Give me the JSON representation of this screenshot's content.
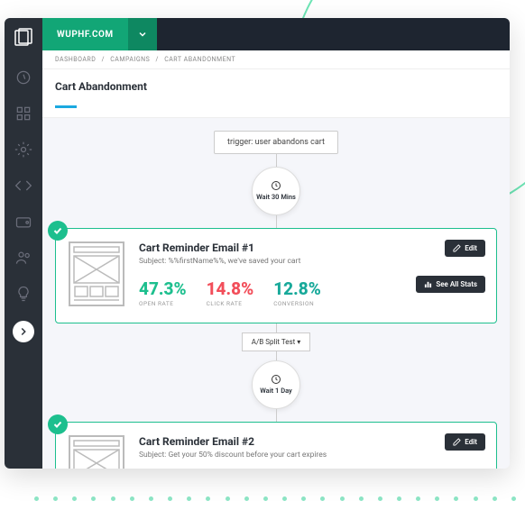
{
  "brand": "WUPHF.COM",
  "breadcrumb": {
    "a": "DASHBOARD",
    "b": "CAMPAIGNS",
    "c": "CART ABANDONMENT"
  },
  "page_title": "Cart Abandonment",
  "trigger": "trigger: user abandons cart",
  "wait1": "Wait 30 Mins",
  "wait2": "Wait 1 Day",
  "split": "A/B Split Test ▾",
  "buttons": {
    "edit": "Edit",
    "stats": "See All Stats"
  },
  "stat_labels": {
    "open": "OPEN RATE",
    "click": "CLICK RATE",
    "conv": "CONVERSION"
  },
  "emails": [
    {
      "title": "Cart Reminder Email #1",
      "subject": "Subject: %%firstName%%, we've saved your cart",
      "open": "47.3%",
      "click": "14.8%",
      "conv": "12.8%"
    },
    {
      "title": "Cart Reminder Email #2",
      "subject": "Subject: Get your 50% discount before your cart expires",
      "open": "",
      "click": "",
      "conv": ""
    }
  ],
  "sidebar_icons": [
    "dashboard-icon",
    "apps-icon",
    "settings-icon",
    "code-icon",
    "wallet-icon",
    "users-icon",
    "idea-icon",
    "next-icon"
  ]
}
